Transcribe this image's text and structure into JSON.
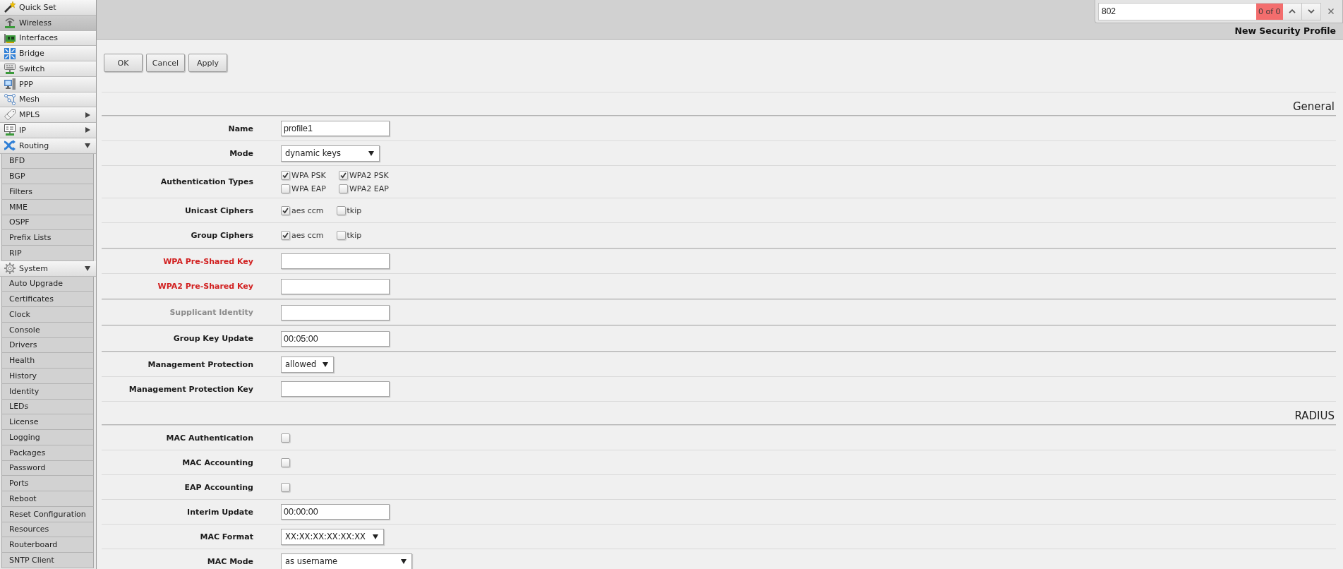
{
  "sidebar": {
    "items": [
      {
        "label": "Quick Set",
        "selected": false
      },
      {
        "label": "Wireless",
        "selected": true
      },
      {
        "label": "Interfaces",
        "selected": false
      },
      {
        "label": "Bridge",
        "selected": false
      },
      {
        "label": "Switch",
        "selected": false
      },
      {
        "label": "PPP",
        "selected": false
      },
      {
        "label": "Mesh",
        "selected": false
      },
      {
        "label": "MPLS",
        "selected": false,
        "expanded": false
      },
      {
        "label": "IP",
        "selected": false,
        "expanded": false
      },
      {
        "label": "Routing",
        "selected": false,
        "expanded": true,
        "children": [
          {
            "label": "BFD",
            "selected": false
          },
          {
            "label": "BGP",
            "selected": false
          },
          {
            "label": "Filters",
            "selected": false
          },
          {
            "label": "MME",
            "selected": false
          },
          {
            "label": "OSPF",
            "selected": false
          },
          {
            "label": "Prefix Lists",
            "selected": false
          },
          {
            "label": "RIP",
            "selected": false
          }
        ]
      },
      {
        "label": "System",
        "selected": false,
        "expanded": true,
        "children": [
          {
            "label": "Auto Upgrade",
            "selected": false
          },
          {
            "label": "Certificates",
            "selected": false
          },
          {
            "label": "Clock",
            "selected": false
          },
          {
            "label": "Console",
            "selected": false
          },
          {
            "label": "Drivers",
            "selected": false
          },
          {
            "label": "Health",
            "selected": false
          },
          {
            "label": "History",
            "selected": false
          },
          {
            "label": "Identity",
            "selected": false
          },
          {
            "label": "LEDs",
            "selected": false
          },
          {
            "label": "License",
            "selected": false
          },
          {
            "label": "Logging",
            "selected": false
          },
          {
            "label": "Packages",
            "selected": false
          },
          {
            "label": "Password",
            "selected": false
          },
          {
            "label": "Ports",
            "selected": false
          },
          {
            "label": "Reboot",
            "selected": false
          },
          {
            "label": "Reset Configuration",
            "selected": false
          },
          {
            "label": "Resources",
            "selected": false
          },
          {
            "label": "Routerboard",
            "selected": false
          },
          {
            "label": "SNTP Client",
            "selected": false
          }
        ]
      }
    ]
  },
  "find_bar": {
    "value": "802",
    "match_count": "0 of 0"
  },
  "title": "New Security Profile",
  "buttons": [
    "OK",
    "Cancel",
    "Apply"
  ],
  "sections": [
    {
      "title": "General",
      "groups": [
        {
          "fields": [
            {
              "label": "Name",
              "kind": "text",
              "value": "profile1",
              "required": false,
              "disabled": false
            },
            {
              "label": "Mode",
              "kind": "select",
              "value": "dynamic keys",
              "required": false,
              "disabled": false
            },
            {
              "label": "Authentication Types",
              "kind": "checkboxes",
              "required": false,
              "disabled": false,
              "options": [
                {
                  "label": "WPA PSK",
                  "checked": true
                },
                {
                  "label": "WPA2 PSK",
                  "checked": true
                },
                {
                  "label": "WPA EAP",
                  "checked": false
                },
                {
                  "label": "WPA2 EAP",
                  "checked": false
                }
              ]
            },
            {
              "label": "Unicast Ciphers",
              "kind": "checkboxes",
              "required": false,
              "disabled": false,
              "options": [
                {
                  "label": "aes ccm",
                  "checked": true
                },
                {
                  "label": "tkip",
                  "checked": false
                }
              ]
            },
            {
              "label": "Group Ciphers",
              "kind": "checkboxes",
              "required": false,
              "disabled": false,
              "options": [
                {
                  "label": "aes ccm",
                  "checked": true
                },
                {
                  "label": "tkip",
                  "checked": false
                }
              ]
            }
          ]
        },
        {
          "fields": [
            {
              "label": "WPA Pre-Shared Key",
              "kind": "text",
              "required": true,
              "disabled": false
            },
            {
              "label": "WPA2 Pre-Shared Key",
              "kind": "text",
              "required": true,
              "disabled": false
            }
          ]
        },
        {
          "fields": [
            {
              "label": "Supplicant Identity",
              "kind": "text",
              "required": false,
              "disabled": true
            }
          ]
        },
        {
          "fields": [
            {
              "label": "Group Key Update",
              "kind": "text",
              "value": "00:05:00",
              "required": false,
              "disabled": false
            }
          ]
        },
        {
          "fields": [
            {
              "label": "Management Protection",
              "kind": "select",
              "value": "allowed",
              "required": false,
              "disabled": false
            },
            {
              "label": "Management Protection Key",
              "kind": "text",
              "required": false,
              "disabled": false
            }
          ]
        }
      ]
    },
    {
      "title": "RADIUS",
      "groups": [
        {
          "fields": [
            {
              "label": "MAC Authentication",
              "kind": "checkbox",
              "checked": false,
              "required": false,
              "disabled": false
            },
            {
              "label": "MAC Accounting",
              "kind": "checkbox",
              "checked": false,
              "required": false,
              "disabled": false
            },
            {
              "label": "EAP Accounting",
              "kind": "checkbox",
              "checked": false,
              "required": false,
              "disabled": false
            },
            {
              "label": "Interim Update",
              "kind": "text",
              "value": "00:00:00",
              "required": false,
              "disabled": false
            },
            {
              "label": "MAC Format",
              "kind": "select",
              "value": "XX:XX:XX:XX:XX:XX",
              "required": false,
              "disabled": false
            },
            {
              "label": "MAC Mode",
              "kind": "select",
              "value": "as username",
              "required": false,
              "disabled": false
            }
          ]
        }
      ]
    }
  ]
}
